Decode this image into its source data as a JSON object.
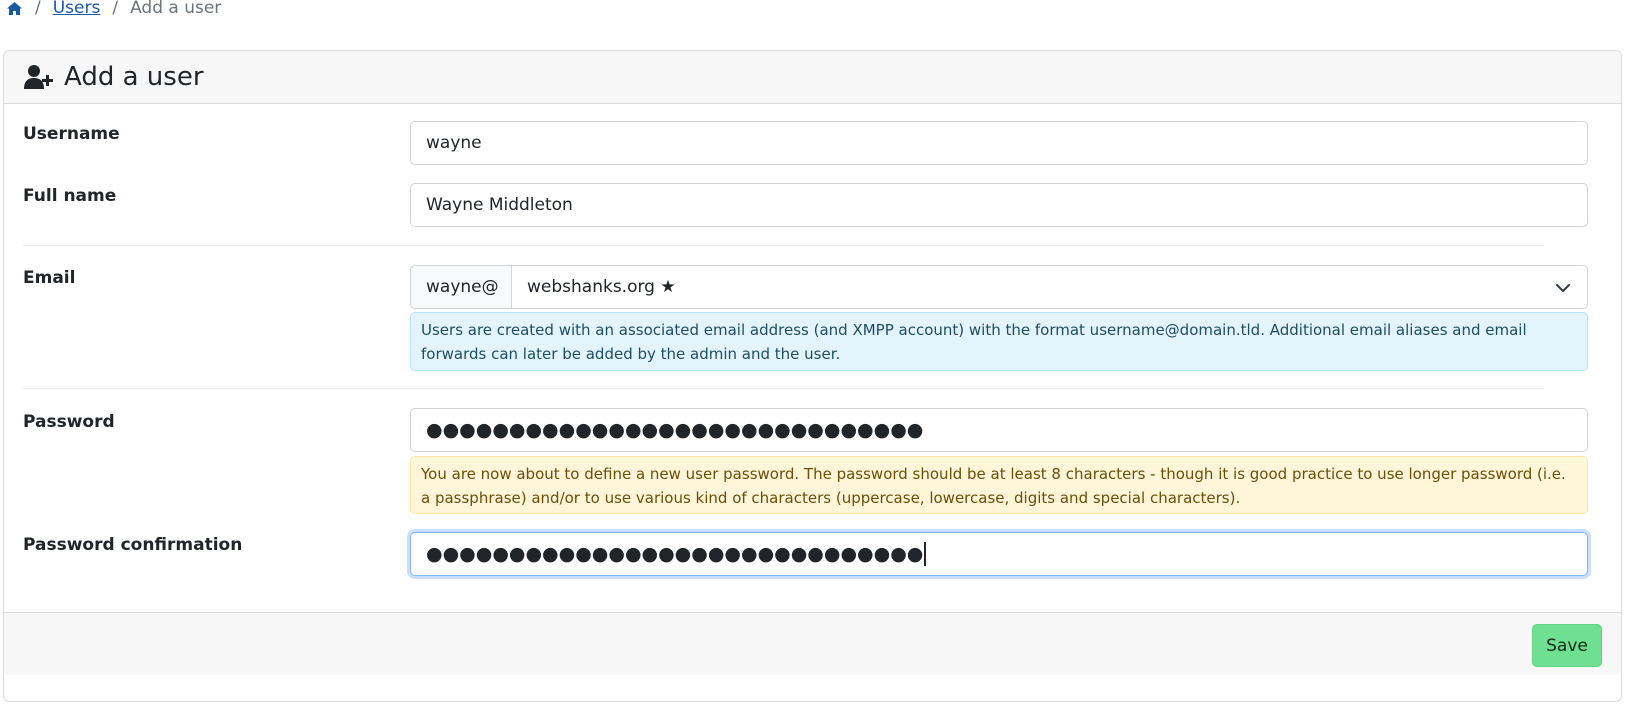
{
  "breadcrumb": {
    "home_icon": "home-icon",
    "users_label": "Users",
    "current_label": "Add a user",
    "separator": "/"
  },
  "card": {
    "header_icon": "user-plus-icon",
    "title": "Add a user"
  },
  "form": {
    "username": {
      "label": "Username",
      "value": "wayne"
    },
    "fullname": {
      "label": "Full name",
      "value": "Wayne Middleton"
    },
    "email": {
      "label": "Email",
      "prefix": "wayne@",
      "domain_selected": "webshanks.org ★",
      "help": "Users are created with an associated email address (and XMPP account) with the format username@domain.tld. Additional email aliases and email forwards can later be added by the admin and the user."
    },
    "password": {
      "label": "Password",
      "value_masked": "●●●●●●●●●●●●●●●●●●●●●●●●●●●●●●",
      "help": "You are now about to define a new user password. The password should be at least 8 characters - though it is good practice to use longer password (i.e. a passphrase) and/or to use various kind of characters (uppercase, lowercase, digits and special characters)."
    },
    "password_confirmation": {
      "label": "Password confirmation",
      "value_masked": "●●●●●●●●●●●●●●●●●●●●●●●●●●●●●●"
    }
  },
  "footer": {
    "save_label": "Save"
  },
  "colors": {
    "link": "#1a5aa0",
    "save_bg": "#6fe091",
    "info_bg": "#e3f4fc",
    "warning_bg": "#fff5d9"
  }
}
